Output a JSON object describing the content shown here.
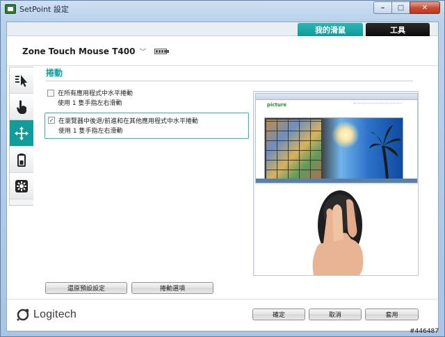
{
  "window": {
    "title": "SetPoint 設定",
    "controls": {
      "minimize": "–",
      "maximize": "□",
      "close": "✕"
    }
  },
  "tabs": [
    {
      "label": "我的滑鼠",
      "active": true
    },
    {
      "label": "工具",
      "active": false
    }
  ],
  "device": {
    "name": "Zone Touch Mouse T400",
    "dropdown_icon": "chevron-down-icon",
    "battery_icon": "battery-icon"
  },
  "sidebar": {
    "items": [
      {
        "icon": "pointer-speed-icon",
        "active": false
      },
      {
        "icon": "hand-pointer-icon",
        "active": false
      },
      {
        "icon": "scroll-move-icon",
        "active": true
      },
      {
        "icon": "battery-level-icon",
        "active": false
      },
      {
        "icon": "settings-cog-icon",
        "active": false
      }
    ]
  },
  "section": {
    "title": "捲動"
  },
  "options": [
    {
      "checked": false,
      "label": "在所有應用程式中水平捲動",
      "sub": "使用 1 隻手指左右滑動"
    },
    {
      "checked": true,
      "label": "在瀏覽器中後退/前進和在其他應用程式中水平捲動",
      "sub": "使用 1 隻手指左右滑動"
    }
  ],
  "preview": {
    "site_logo": "picture"
  },
  "buttons": {
    "restore": "還原預設設定",
    "scroll_options": "捲動選項",
    "ok": "確定",
    "cancel": "取消",
    "apply": "套用"
  },
  "logo": {
    "text": "Logitech"
  },
  "watermark": "#446487",
  "colors": {
    "accent": "#0f9c9b",
    "tab_inactive": "#111111",
    "section_title": "#0e9f9f"
  }
}
